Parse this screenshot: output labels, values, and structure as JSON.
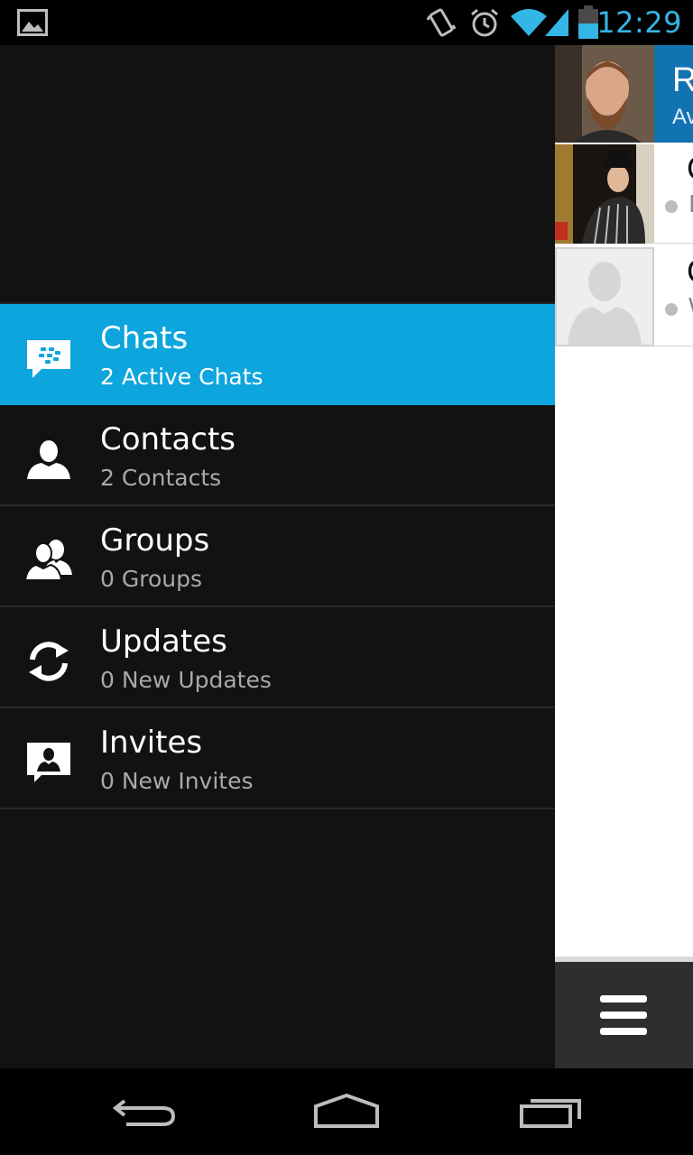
{
  "status_bar": {
    "time": "12:29",
    "icons": [
      "image-notification-icon",
      "vibrate-icon",
      "alarm-icon",
      "wifi-icon",
      "signal-icon",
      "battery-icon"
    ]
  },
  "drawer": {
    "items": [
      {
        "title": "Chats",
        "subtitle": "2 Active Chats",
        "icon": "bbm-chat-icon",
        "active": true
      },
      {
        "title": "Contacts",
        "subtitle": "2 Contacts",
        "icon": "contact-icon",
        "active": false
      },
      {
        "title": "Groups",
        "subtitle": "0 Groups",
        "icon": "groups-icon",
        "active": false
      },
      {
        "title": "Updates",
        "subtitle": "0 New Updates",
        "icon": "refresh-icon",
        "active": false
      },
      {
        "title": "Invites",
        "subtitle": "0 New Invites",
        "icon": "invite-icon",
        "active": false
      }
    ]
  },
  "peek": {
    "header_name": "R",
    "header_status": "Av",
    "rows": [
      {
        "name": "C",
        "status": "I"
      },
      {
        "name": "C",
        "status": "W"
      }
    ]
  },
  "colors": {
    "accent": "#0ca5dd",
    "clock": "#33b5e5",
    "header": "#1273b3"
  }
}
